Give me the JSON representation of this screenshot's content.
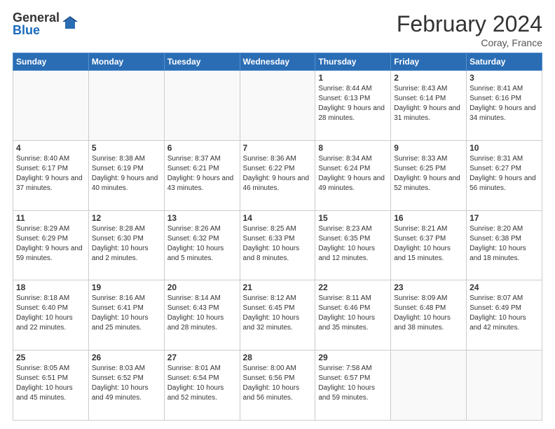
{
  "logo": {
    "general": "General",
    "blue": "Blue"
  },
  "title": {
    "month_year": "February 2024",
    "location": "Coray, France"
  },
  "days_of_week": [
    "Sunday",
    "Monday",
    "Tuesday",
    "Wednesday",
    "Thursday",
    "Friday",
    "Saturday"
  ],
  "weeks": [
    [
      {
        "day": "",
        "info": ""
      },
      {
        "day": "",
        "info": ""
      },
      {
        "day": "",
        "info": ""
      },
      {
        "day": "",
        "info": ""
      },
      {
        "day": "1",
        "info": "Sunrise: 8:44 AM\nSunset: 6:13 PM\nDaylight: 9 hours and 28 minutes."
      },
      {
        "day": "2",
        "info": "Sunrise: 8:43 AM\nSunset: 6:14 PM\nDaylight: 9 hours and 31 minutes."
      },
      {
        "day": "3",
        "info": "Sunrise: 8:41 AM\nSunset: 6:16 PM\nDaylight: 9 hours and 34 minutes."
      }
    ],
    [
      {
        "day": "4",
        "info": "Sunrise: 8:40 AM\nSunset: 6:17 PM\nDaylight: 9 hours and 37 minutes."
      },
      {
        "day": "5",
        "info": "Sunrise: 8:38 AM\nSunset: 6:19 PM\nDaylight: 9 hours and 40 minutes."
      },
      {
        "day": "6",
        "info": "Sunrise: 8:37 AM\nSunset: 6:21 PM\nDaylight: 9 hours and 43 minutes."
      },
      {
        "day": "7",
        "info": "Sunrise: 8:36 AM\nSunset: 6:22 PM\nDaylight: 9 hours and 46 minutes."
      },
      {
        "day": "8",
        "info": "Sunrise: 8:34 AM\nSunset: 6:24 PM\nDaylight: 9 hours and 49 minutes."
      },
      {
        "day": "9",
        "info": "Sunrise: 8:33 AM\nSunset: 6:25 PM\nDaylight: 9 hours and 52 minutes."
      },
      {
        "day": "10",
        "info": "Sunrise: 8:31 AM\nSunset: 6:27 PM\nDaylight: 9 hours and 56 minutes."
      }
    ],
    [
      {
        "day": "11",
        "info": "Sunrise: 8:29 AM\nSunset: 6:29 PM\nDaylight: 9 hours and 59 minutes."
      },
      {
        "day": "12",
        "info": "Sunrise: 8:28 AM\nSunset: 6:30 PM\nDaylight: 10 hours and 2 minutes."
      },
      {
        "day": "13",
        "info": "Sunrise: 8:26 AM\nSunset: 6:32 PM\nDaylight: 10 hours and 5 minutes."
      },
      {
        "day": "14",
        "info": "Sunrise: 8:25 AM\nSunset: 6:33 PM\nDaylight: 10 hours and 8 minutes."
      },
      {
        "day": "15",
        "info": "Sunrise: 8:23 AM\nSunset: 6:35 PM\nDaylight: 10 hours and 12 minutes."
      },
      {
        "day": "16",
        "info": "Sunrise: 8:21 AM\nSunset: 6:37 PM\nDaylight: 10 hours and 15 minutes."
      },
      {
        "day": "17",
        "info": "Sunrise: 8:20 AM\nSunset: 6:38 PM\nDaylight: 10 hours and 18 minutes."
      }
    ],
    [
      {
        "day": "18",
        "info": "Sunrise: 8:18 AM\nSunset: 6:40 PM\nDaylight: 10 hours and 22 minutes."
      },
      {
        "day": "19",
        "info": "Sunrise: 8:16 AM\nSunset: 6:41 PM\nDaylight: 10 hours and 25 minutes."
      },
      {
        "day": "20",
        "info": "Sunrise: 8:14 AM\nSunset: 6:43 PM\nDaylight: 10 hours and 28 minutes."
      },
      {
        "day": "21",
        "info": "Sunrise: 8:12 AM\nSunset: 6:45 PM\nDaylight: 10 hours and 32 minutes."
      },
      {
        "day": "22",
        "info": "Sunrise: 8:11 AM\nSunset: 6:46 PM\nDaylight: 10 hours and 35 minutes."
      },
      {
        "day": "23",
        "info": "Sunrise: 8:09 AM\nSunset: 6:48 PM\nDaylight: 10 hours and 38 minutes."
      },
      {
        "day": "24",
        "info": "Sunrise: 8:07 AM\nSunset: 6:49 PM\nDaylight: 10 hours and 42 minutes."
      }
    ],
    [
      {
        "day": "25",
        "info": "Sunrise: 8:05 AM\nSunset: 6:51 PM\nDaylight: 10 hours and 45 minutes."
      },
      {
        "day": "26",
        "info": "Sunrise: 8:03 AM\nSunset: 6:52 PM\nDaylight: 10 hours and 49 minutes."
      },
      {
        "day": "27",
        "info": "Sunrise: 8:01 AM\nSunset: 6:54 PM\nDaylight: 10 hours and 52 minutes."
      },
      {
        "day": "28",
        "info": "Sunrise: 8:00 AM\nSunset: 6:56 PM\nDaylight: 10 hours and 56 minutes."
      },
      {
        "day": "29",
        "info": "Sunrise: 7:58 AM\nSunset: 6:57 PM\nDaylight: 10 hours and 59 minutes."
      },
      {
        "day": "",
        "info": ""
      },
      {
        "day": "",
        "info": ""
      }
    ]
  ]
}
